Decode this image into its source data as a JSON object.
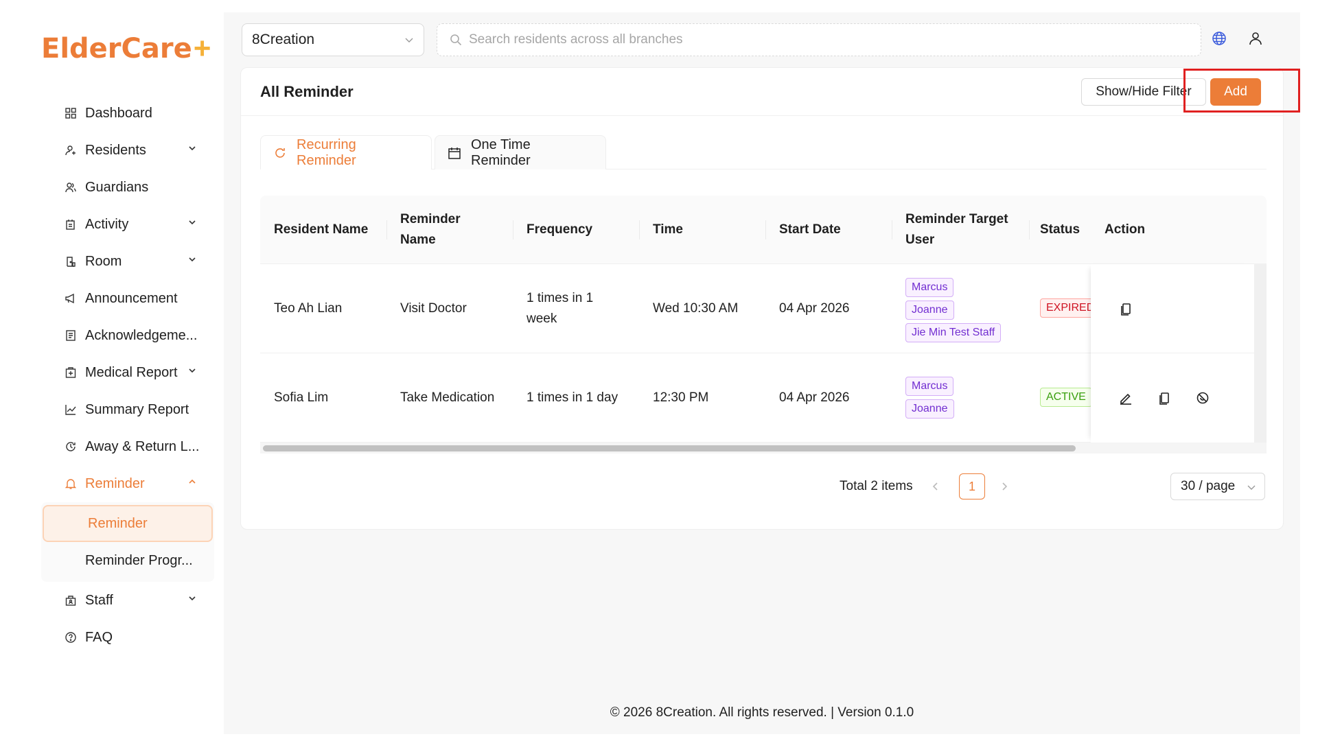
{
  "app": {
    "logo_text": "ElderCare",
    "logo_plus": "+"
  },
  "sidebar": {
    "items": [
      {
        "label": "Dashboard",
        "icon": "dashboard-icon"
      },
      {
        "label": "Residents",
        "icon": "residents-icon",
        "has_chevron": true
      },
      {
        "label": "Guardians",
        "icon": "guardians-icon"
      },
      {
        "label": "Activity",
        "icon": "activity-icon",
        "has_chevron": true
      },
      {
        "label": "Room",
        "icon": "room-icon",
        "has_chevron": true
      },
      {
        "label": "Announcement",
        "icon": "megaphone-icon"
      },
      {
        "label": "Acknowledgeme...",
        "icon": "document-icon"
      },
      {
        "label": "Medical Report",
        "icon": "medical-icon",
        "has_chevron": true
      },
      {
        "label": "Summary Report",
        "icon": "chart-icon"
      },
      {
        "label": "Away & Return L...",
        "icon": "clock-icon"
      },
      {
        "label": "Reminder",
        "icon": "bell-icon",
        "expanded": true
      },
      {
        "label": "Staff",
        "icon": "staff-icon",
        "has_chevron": true
      },
      {
        "label": "FAQ",
        "icon": "help-icon"
      }
    ],
    "reminder_sub": [
      {
        "label": "Reminder",
        "selected": true
      },
      {
        "label": "Reminder Progr..."
      }
    ]
  },
  "topbar": {
    "branch": "8Creation",
    "search_placeholder": "Search residents across all branches"
  },
  "card": {
    "title": "All Reminder",
    "filter_button": "Show/Hide Filter",
    "add_button": "Add"
  },
  "tabs": [
    {
      "label": "Recurring Reminder",
      "active": true
    },
    {
      "label": "One Time Reminder"
    }
  ],
  "table": {
    "columns": [
      "Resident Name",
      "Reminder Name",
      "Frequency",
      "Time",
      "Start Date",
      "Reminder Target User",
      "Status",
      "Action"
    ],
    "rows": [
      {
        "resident": "Teo Ah Lian",
        "reminder": "Visit Doctor",
        "frequency": "1 times in 1 week",
        "time": "Wed 10:30 AM",
        "start_date": "04 Apr 2026",
        "targets": [
          "Marcus",
          "Joanne",
          "Jie Min Test Staff"
        ],
        "status": "EXPIRED"
      },
      {
        "resident": "Sofia Lim",
        "reminder": "Take Medication",
        "frequency": "1 times in 1 day",
        "time": "12:30 PM",
        "start_date": "04 Apr 2026",
        "targets": [
          "Marcus",
          "Joanne"
        ],
        "status": "ACTIVE"
      }
    ]
  },
  "pagination": {
    "total": "Total 2 items",
    "current_page": "1",
    "page_size": "30 / page"
  },
  "footer": "© 2026 8Creation. All rights reserved. | Version 0.1.0",
  "colors": {
    "accent": "#ec7d38",
    "tag": "#722ed1",
    "expired": "#cf1322",
    "active": "#389e0d"
  }
}
